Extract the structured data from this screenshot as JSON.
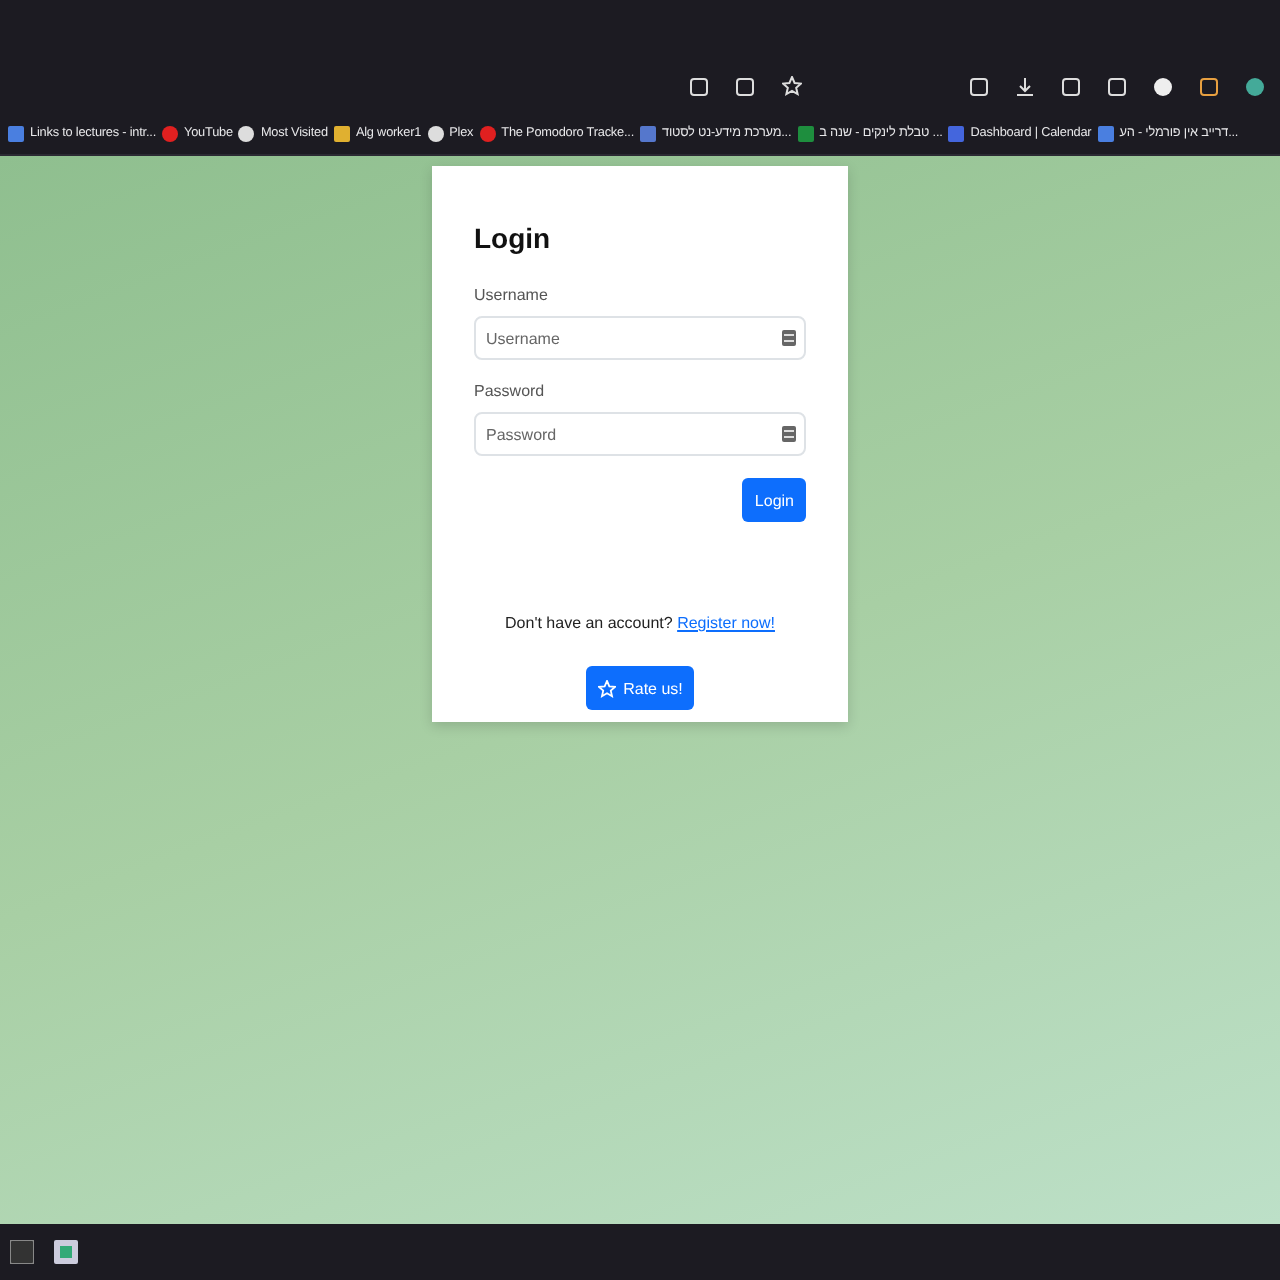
{
  "bookmarks": [
    {
      "label": "Links to lectures - intr...",
      "kind": "doc"
    },
    {
      "label": "YouTube",
      "kind": "red"
    },
    {
      "label": "Most Visited",
      "kind": "gear"
    },
    {
      "label": "Alg worker1",
      "kind": "face"
    },
    {
      "label": "Plex",
      "kind": "globe"
    },
    {
      "label": "The Pomodoro Tracke...",
      "kind": "red"
    },
    {
      "label": "מערכת מידע-נט לסטוד...",
      "kind": "figure"
    },
    {
      "label": "טבלת לינקים - שנה ב ...",
      "kind": "sheet"
    },
    {
      "label": "Dashboard | Calendar",
      "kind": "cal"
    },
    {
      "label": "דרייב אין פורמלי - הע...",
      "kind": "doc"
    }
  ],
  "login": {
    "title": "Login",
    "fields": [
      {
        "label": "Username",
        "placeholder": "Username"
      },
      {
        "label": "Password",
        "placeholder": "Password"
      }
    ],
    "submit": "Login",
    "prompt": "Don't have an account?",
    "register_link": "Register now!",
    "rate_button": "Rate us!"
  }
}
